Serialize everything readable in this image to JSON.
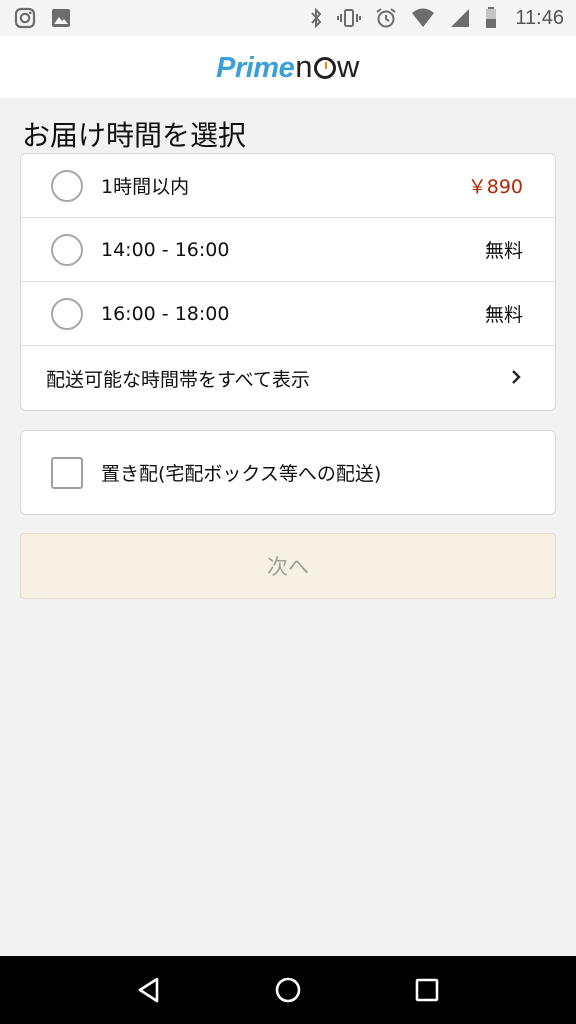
{
  "status_bar": {
    "time": "11:46",
    "left_icons": [
      "instagram-icon",
      "image-icon"
    ],
    "right_icons": [
      "bluetooth-icon",
      "vibrate-icon",
      "alarm-icon",
      "wifi-icon",
      "signal-icon",
      "battery-icon"
    ]
  },
  "header": {
    "logo_prime": "Prime",
    "logo_now_n": "n",
    "logo_now_w": "w"
  },
  "page": {
    "title": "お届け時間を選択"
  },
  "delivery_slots": [
    {
      "label": "1時間以内",
      "price": "￥890",
      "paid": true
    },
    {
      "label": "14:00 - 16:00",
      "price": "無料",
      "paid": false
    },
    {
      "label": "16:00 - 18:00",
      "price": "無料",
      "paid": false
    }
  ],
  "show_all_label": "配送可能な時間帯をすべて表示",
  "unattended_label": "置き配(宅配ボックス等への配送)",
  "next_button_label": "次へ",
  "colors": {
    "accent_blue": "#3aa1d6",
    "price_red": "#b12704",
    "button_disabled_bg": "#f7f1e3"
  }
}
